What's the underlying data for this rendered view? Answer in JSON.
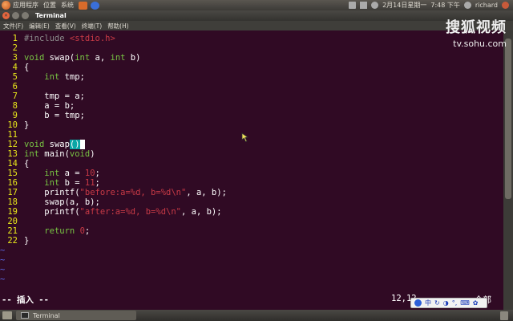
{
  "top_panel": {
    "menus": [
      "应用程序",
      "位置",
      "系统"
    ],
    "date": "2月14日星期一",
    "time": "7:48 下午",
    "user": "richard"
  },
  "window": {
    "title": "Terminal"
  },
  "menubar": [
    "文件(F)",
    "编辑(E)",
    "查看(V)",
    "终端(T)",
    "帮助(H)"
  ],
  "watermark": {
    "brand": "搜狐视频",
    "url": "tv.sohu.com"
  },
  "code_lines": [
    {
      "n": "1",
      "segs": [
        {
          "t": "#include ",
          "c": "pre"
        },
        {
          "t": "<stdio.h>",
          "c": "str"
        }
      ]
    },
    {
      "n": "2",
      "segs": []
    },
    {
      "n": "3",
      "segs": [
        {
          "t": "void",
          "c": "kw"
        },
        {
          "t": " swap(",
          "c": ""
        },
        {
          "t": "int",
          "c": "kw"
        },
        {
          "t": " a, ",
          "c": ""
        },
        {
          "t": "int",
          "c": "kw"
        },
        {
          "t": " b)",
          "c": ""
        }
      ]
    },
    {
      "n": "4",
      "segs": [
        {
          "t": "{",
          "c": ""
        }
      ]
    },
    {
      "n": "5",
      "segs": [
        {
          "t": "    ",
          "c": ""
        },
        {
          "t": "int",
          "c": "kw"
        },
        {
          "t": " tmp;",
          "c": ""
        }
      ]
    },
    {
      "n": "6",
      "segs": []
    },
    {
      "n": "7",
      "segs": [
        {
          "t": "    tmp = a;",
          "c": ""
        }
      ]
    },
    {
      "n": "8",
      "segs": [
        {
          "t": "    a = b;",
          "c": ""
        }
      ]
    },
    {
      "n": "9",
      "segs": [
        {
          "t": "    b = tmp;",
          "c": ""
        }
      ]
    },
    {
      "n": "10",
      "segs": [
        {
          "t": "}",
          "c": ""
        }
      ]
    },
    {
      "n": "11",
      "segs": []
    },
    {
      "n": "12",
      "segs": [
        {
          "t": "void",
          "c": "kw"
        },
        {
          "t": " swap",
          "c": ""
        },
        {
          "t": "()",
          "c": "paren-hl"
        },
        {
          "t": " ",
          "c": "cursor"
        }
      ]
    },
    {
      "n": "13",
      "segs": [
        {
          "t": "int",
          "c": "kw"
        },
        {
          "t": " main(",
          "c": ""
        },
        {
          "t": "void",
          "c": "kw"
        },
        {
          "t": ")",
          "c": ""
        }
      ]
    },
    {
      "n": "14",
      "segs": [
        {
          "t": "{",
          "c": ""
        }
      ]
    },
    {
      "n": "15",
      "segs": [
        {
          "t": "    ",
          "c": ""
        },
        {
          "t": "int",
          "c": "kw"
        },
        {
          "t": " a = ",
          "c": ""
        },
        {
          "t": "10",
          "c": "num"
        },
        {
          "t": ";",
          "c": ""
        }
      ]
    },
    {
      "n": "16",
      "segs": [
        {
          "t": "    ",
          "c": ""
        },
        {
          "t": "int",
          "c": "kw"
        },
        {
          "t": " b = ",
          "c": ""
        },
        {
          "t": "11",
          "c": "num"
        },
        {
          "t": ";",
          "c": ""
        }
      ]
    },
    {
      "n": "17",
      "segs": [
        {
          "t": "    printf(",
          "c": ""
        },
        {
          "t": "\"before:a=%d, b=%d\\n\"",
          "c": "str"
        },
        {
          "t": ", a, b);",
          "c": ""
        }
      ]
    },
    {
      "n": "18",
      "segs": [
        {
          "t": "    swap(a, b);",
          "c": ""
        }
      ]
    },
    {
      "n": "19",
      "segs": [
        {
          "t": "    printf(",
          "c": ""
        },
        {
          "t": "\"after:a=%d, b=%d\\n\"",
          "c": "str"
        },
        {
          "t": ", a, b);",
          "c": ""
        }
      ]
    },
    {
      "n": "20",
      "segs": []
    },
    {
      "n": "21",
      "segs": [
        {
          "t": "    ",
          "c": ""
        },
        {
          "t": "return",
          "c": "kw"
        },
        {
          "t": " ",
          "c": ""
        },
        {
          "t": "0",
          "c": "num"
        },
        {
          "t": ";",
          "c": ""
        }
      ]
    },
    {
      "n": "22",
      "segs": [
        {
          "t": "}",
          "c": ""
        }
      ]
    }
  ],
  "tilde_lines": [
    "~",
    "~",
    "~",
    "~"
  ],
  "status": {
    "mode": "-- 插入 --",
    "position": "12,12",
    "percent": "全部"
  },
  "ime": {
    "lang": "中"
  },
  "taskbar": {
    "task_label": "Terminal"
  },
  "colors": {
    "terminal_bg": "#300a24",
    "line_number": "#e9e91a",
    "keyword": "#78c443",
    "string": "#c83a46",
    "tilde": "#5c69e5"
  }
}
